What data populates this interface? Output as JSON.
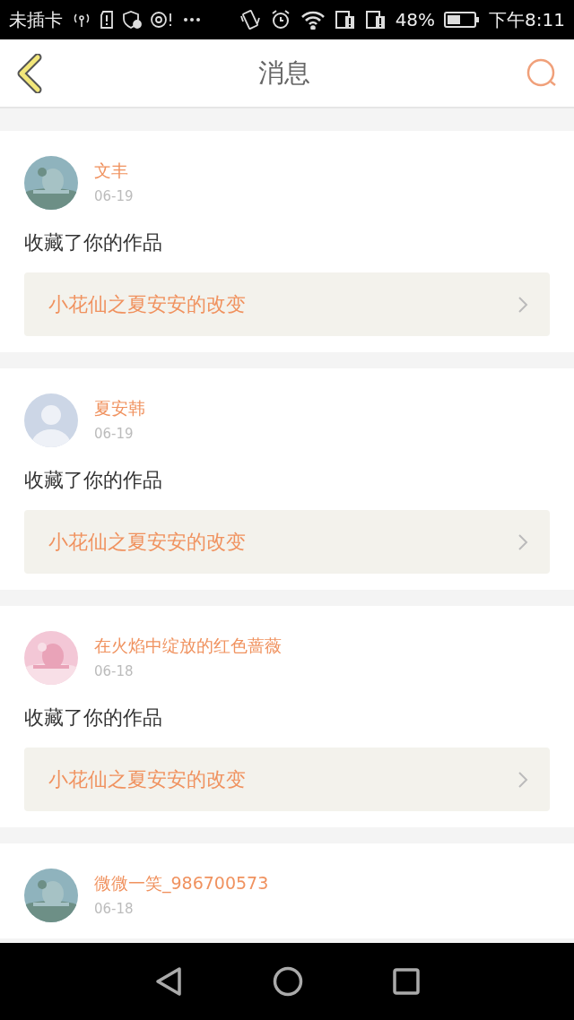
{
  "status_bar": {
    "carrier": "未插卡",
    "battery": "48%",
    "time": "下午8:11"
  },
  "header": {
    "title": "消息"
  },
  "messages": [
    {
      "user": "文丰",
      "date": "06-19",
      "action": "收藏了你的作品",
      "work": "小花仙之夏安安的改变"
    },
    {
      "user": "夏安韩",
      "date": "06-19",
      "action": "收藏了你的作品",
      "work": "小花仙之夏安安的改变",
      "avatar": {
        "kind": "default"
      }
    },
    {
      "user": "在火焰中绽放的红色蔷薇",
      "date": "06-18",
      "action": "收藏了你的作品",
      "work": "小花仙之夏安安的改变"
    },
    {
      "user": "微微一笑_986700573",
      "date": "06-18"
    }
  ]
}
